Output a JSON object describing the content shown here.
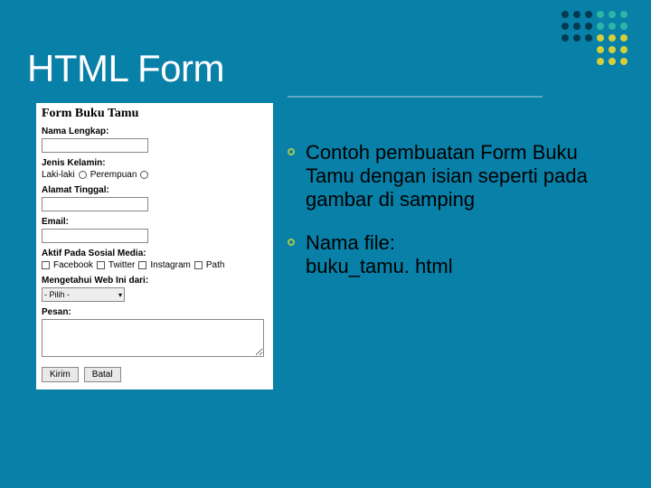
{
  "title": "HTML Form",
  "bullets": {
    "desc": "Contoh pembuatan Form Buku Tamu dengan isian seperti pada gambar di samping",
    "filename_label": "Nama file:",
    "filename_value": "buku_tamu. html"
  },
  "form": {
    "heading": "Form Buku Tamu",
    "nama_label": "Nama Lengkap:",
    "jk_label": "Jenis Kelamin:",
    "jk_opt1": "Laki-laki",
    "jk_opt2": "Perempuan",
    "alamat_label": "Alamat Tinggal:",
    "email_label": "Email:",
    "sosmed_label": "Aktif Pada Sosial Media:",
    "sosmed_opts": {
      "a": "Facebook",
      "b": "Twitter",
      "c": "Instagram",
      "d": "Path"
    },
    "sumber_label": "Mengetahui Web Ini dari:",
    "sumber_value": "-  Pilih   -",
    "pesan_label": "Pesan:",
    "btn_submit": "Kirim",
    "btn_reset": "Batal"
  }
}
